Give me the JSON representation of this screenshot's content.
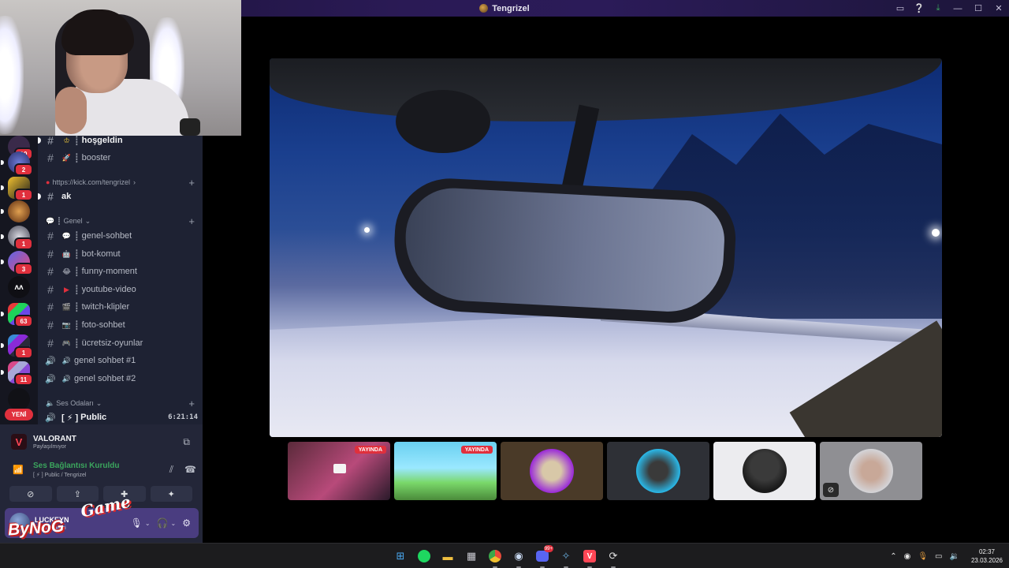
{
  "window": {
    "title": "Tengrizel",
    "controls": {
      "minimize": "—",
      "maximize": "☐",
      "close": "✕"
    }
  },
  "server_rail": {
    "badges": [
      "10",
      "2",
      "1",
      "1",
      "3",
      "63",
      "1",
      "11"
    ],
    "new_label": "YENİ"
  },
  "channels": {
    "items": [
      {
        "name": "hoşgeldin",
        "prefix": "┋",
        "emoji": "♔",
        "bold": true
      },
      {
        "name": "booster",
        "prefix": "┋",
        "emoji": "🚀",
        "bold": false
      }
    ],
    "kick_category": "https://kick.com/tengrizel",
    "kick_channel": "ak",
    "genel_category": "Genel",
    "genel_items": [
      {
        "name": "genel-sohbet",
        "prefix": "┋",
        "emoji": "💬"
      },
      {
        "name": "bot-komut",
        "prefix": "┋",
        "emoji": "🤖"
      },
      {
        "name": "funny-moment",
        "prefix": "┋",
        "emoji": "😂"
      },
      {
        "name": "youtube-video",
        "prefix": "┋",
        "emoji": "▶"
      },
      {
        "name": "twitch-klipler",
        "prefix": "┋",
        "emoji": "🎬"
      },
      {
        "name": "foto-sohbet",
        "prefix": "┋",
        "emoji": "📷"
      },
      {
        "name": "ücretsiz-oyunlar",
        "prefix": "┋",
        "emoji": "🎮"
      }
    ],
    "voice_items": [
      "genel sohbet #1",
      "genel sohbet #2"
    ],
    "voice_category": "Ses Odaları",
    "public_channel": {
      "name": "Public",
      "prefix": "[ ⚡ ]",
      "time": "6:21:14"
    }
  },
  "activity": {
    "game": "VALORANT",
    "status": "Paylaşılmıyor"
  },
  "voice_status": {
    "title": "Ses Bağlantısı Kuruldu",
    "detail": "[ ⚡ ] Public / Tengrizel"
  },
  "user": {
    "name": "LUCKEYN",
    "status": "yandı, cambi"
  },
  "overlay_logo": {
    "top": "Game",
    "bottom": "ByNoG"
  },
  "stream_thumbs": {
    "live_label": "YAYINDA"
  },
  "taskbar": {
    "notification_badge": "99+",
    "time": "02:37",
    "date": "23.03.2026"
  },
  "colors": {
    "accent_purple": "#4a3d80",
    "live_red": "#e0303d",
    "connected_green": "#3ba55d"
  }
}
